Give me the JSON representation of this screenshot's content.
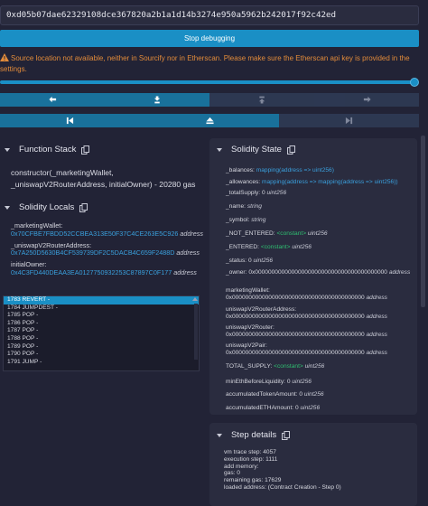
{
  "tx_hash": "0xd05b07dae62329108dce367820a2b1a1d14b3274e950a5962b242017f92c42ed",
  "stop_debugging_label": "Stop debugging",
  "warning_text": "Source location not available, neither in Sourcify nor in Etherscan. Please make sure the Etherscan api key is provided in the settings.",
  "step_slider": {
    "position_fraction": 1.0
  },
  "colors": {
    "accent": "#1a8fc5",
    "warning": "#e28b3a",
    "constant": "#2fbf71",
    "value": "#3aa0dd",
    "background": "#222336",
    "panel": "#2a2c3f"
  },
  "nav_row1": [
    "step-back-icon",
    "step-into-icon",
    "step-over-back-icon",
    "step-over-forward-icon"
  ],
  "nav_row2": [
    "jump-previous-breakpoint-icon",
    "jump-out-icon",
    "jump-next-breakpoint-icon"
  ],
  "function_stack": {
    "title": "Function Stack",
    "entry": "constructor(_marketingWallet, _uniswapV2RouterAddress, initialOwner) - 20280 gas"
  },
  "solidity_locals": {
    "title": "Solidity Locals",
    "items": [
      {
        "name": "_marketingWallet:",
        "value": "0x70CFBE7FBDD52CCBEA313E50F37C4CE263E5C926",
        "type": "address"
      },
      {
        "name": "_uniswapV2RouterAddress:",
        "value": "0x7A250D5630B4CF539739DF2C5DACB4C659F2488D",
        "type": "address"
      },
      {
        "name": "initialOwner:",
        "value": "0x4C3FD440DEAA3EA0127750932253C87897C0F177",
        "type": "address"
      }
    ]
  },
  "opcodes": [
    "1783 REVERT -",
    "1784 JUMPDEST -",
    "1785 POP -",
    "1786 POP -",
    "1787 POP -",
    "1788 POP -",
    "1789 POP -",
    "1790 POP -",
    "1791 JUMP -"
  ],
  "solidity_state": {
    "title": "Solidity State",
    "items": [
      {
        "name": "_balances:",
        "value": "mapping(address => uint256)",
        "kind": "val"
      },
      {
        "name": "_allowances:",
        "value": "mapping(address => mapping(address => uint256))",
        "kind": "val"
      },
      {
        "name": "_totalSupply:",
        "value": "0",
        "type": "uint256",
        "kind": "plain"
      },
      {
        "name": "_name:",
        "type": "string",
        "kind": "typeonly"
      },
      {
        "name": "_symbol:",
        "type": "string",
        "kind": "typeonly"
      },
      {
        "name": "_NOT_ENTERED:",
        "value": "<constant>",
        "type": "uint256",
        "kind": "const"
      },
      {
        "name": "_ENTERED:",
        "value": "<constant>",
        "type": "uint256",
        "kind": "const"
      },
      {
        "name": "_status:",
        "value": "0",
        "type": "uint256",
        "kind": "plain"
      },
      {
        "name": "_owner:",
        "value": "0x0000000000000000000000000000000000000000",
        "type": "address",
        "kind": "plain"
      },
      {
        "name": "marketingWallet:",
        "value": "0x0000000000000000000000000000000000000000",
        "type": "address",
        "kind": "block"
      },
      {
        "name": "uniswapV2RouterAddress:",
        "value": "0x0000000000000000000000000000000000000000",
        "type": "address",
        "kind": "block"
      },
      {
        "name": "uniswapV2Router:",
        "value": "0x0000000000000000000000000000000000000000",
        "type": "address",
        "kind": "block"
      },
      {
        "name": "uniswapV2Pair:",
        "value": "0x0000000000000000000000000000000000000000",
        "type": "address",
        "kind": "block"
      },
      {
        "name": "TOTAL_SUPPLY:",
        "value": "<constant>",
        "type": "uint256",
        "kind": "const"
      },
      {
        "name": "minEthBeforeLiquidity:",
        "value": "0",
        "type": "uint256",
        "kind": "plain"
      },
      {
        "name": "accumulatedTokenAmount:",
        "value": "0",
        "type": "uint256",
        "kind": "plain"
      },
      {
        "name": "accumulatedETHAmount:",
        "value": "0",
        "type": "uint256",
        "kind": "plain"
      }
    ]
  },
  "step_details": {
    "title": "Step details",
    "lines": [
      "vm trace step: 4057",
      "execution step: 1111",
      "add memory:",
      "gas: 0",
      "remaining gas: 17629",
      "loaded address: (Contract Creation - Step 0)"
    ]
  }
}
